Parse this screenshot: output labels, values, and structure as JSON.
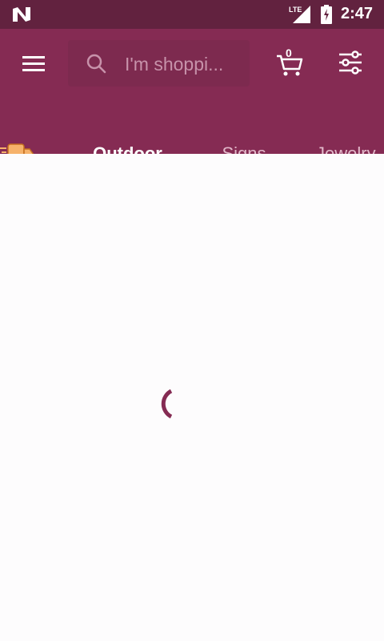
{
  "status_bar": {
    "time": "2:47",
    "network": "LTE",
    "icons": [
      "android-n-logo-icon",
      "lte-signal-icon",
      "battery-charging-icon"
    ]
  },
  "app_bar": {
    "search": {
      "placeholder": "I'm shoppi..."
    },
    "cart": {
      "count": "0"
    },
    "icons": [
      "menu-icon",
      "search-icon",
      "cart-icon",
      "filter-icon"
    ]
  },
  "tabs": {
    "items": [
      {
        "label": "Outdoor",
        "active": true
      },
      {
        "label": "Signs",
        "active": false
      },
      {
        "label": "Jewelry",
        "active": false
      }
    ],
    "lead_icon": "delivery-truck-icon"
  },
  "content": {
    "state": "loading"
  },
  "colors": {
    "status_bar": "#62223f",
    "brand": "#852b53",
    "search_bg": "#7d2a4f",
    "inactive_tab": "#e2b8ca",
    "truck": "#f6b26b",
    "background": "#fdfcfd"
  }
}
